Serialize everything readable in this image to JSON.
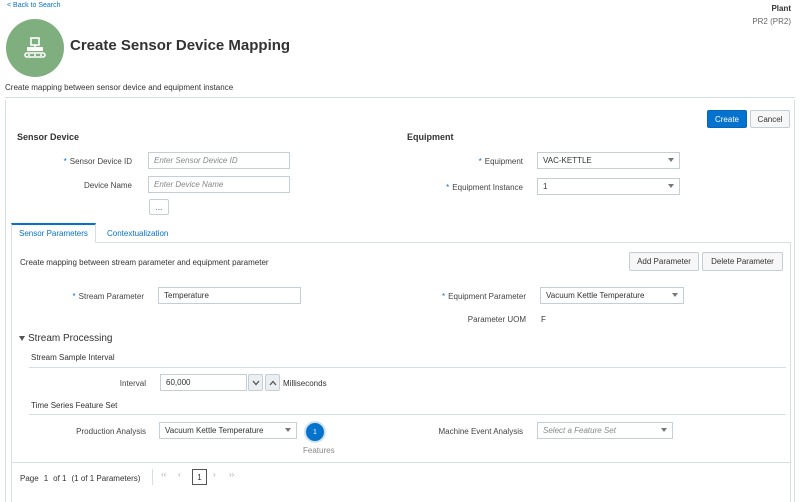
{
  "header": {
    "back_link": "< Back to Search",
    "plant_label": "Plant",
    "plant_value": "PR2 (PR2)",
    "title": "Create Sensor Device Mapping",
    "subtitle": "Create mapping between sensor device and equipment instance"
  },
  "actions": {
    "create": "Create",
    "cancel": "Cancel"
  },
  "sensor_device": {
    "title": "Sensor Device",
    "id_label": "Sensor Device ID",
    "id_placeholder": "Enter Sensor Device ID",
    "name_label": "Device Name",
    "name_placeholder": "Enter Device Name",
    "more_button": "..."
  },
  "equipment": {
    "title": "Equipment",
    "equipment_label": "Equipment",
    "equipment_value": "VAC-KETTLE",
    "instance_label": "Equipment Instance",
    "instance_value": "1"
  },
  "tabs": [
    {
      "label": "Sensor Parameters",
      "active": true
    },
    {
      "label": "Contextualization",
      "active": false
    }
  ],
  "sensor_params": {
    "description": "Create mapping between stream parameter and equipment parameter",
    "add_button": "Add Parameter",
    "delete_button": "Delete Parameter",
    "stream_label": "Stream Parameter",
    "stream_value": "Temperature",
    "equip_param_label": "Equipment Parameter",
    "equip_param_value": "Vacuum Kettle Temperature",
    "uom_label": "Parameter UOM",
    "uom_value": "F"
  },
  "stream_processing": {
    "title": "Stream Processing",
    "sample_interval_title": "Stream Sample Interval",
    "interval_label": "Interval",
    "interval_value": "60,000",
    "interval_unit": "Milliseconds",
    "feature_set_title": "Time Series Feature Set",
    "production_label": "Production Analysis",
    "production_value": "Vacuum Kettle Temperature",
    "features_count": "1",
    "features_label": "Features",
    "machine_label": "Machine Event Analysis",
    "machine_placeholder": "Select a Feature Set"
  },
  "pager": {
    "page_label": "Page",
    "page_num": "1",
    "of_label": "of 1",
    "summary": "(1 of 1 Parameters)",
    "current": "1"
  },
  "colors": {
    "accent": "#0572ce",
    "avatar": "#7faf7f"
  }
}
